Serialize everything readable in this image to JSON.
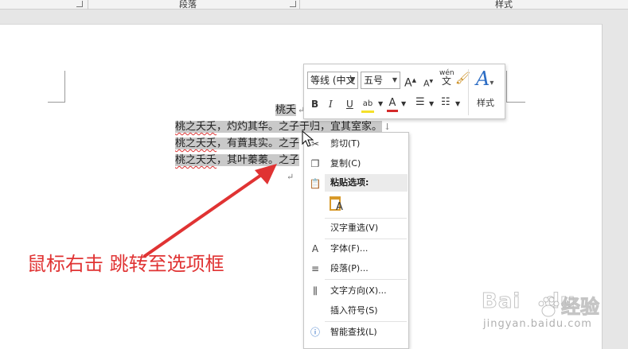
{
  "ribbon": {
    "group_paragraph": "段落",
    "group_styles": "样式"
  },
  "document": {
    "title_line": "桃夭",
    "lines": [
      {
        "left": "桃之夭夭",
        "rest": "，灼灼其华。之子于归，宜其室家。"
      },
      {
        "left": "桃之夭夭",
        "rest": "，有蕡其实。之子"
      },
      {
        "left": "桃之夭夭",
        "rest": "，其叶蓁蓁。之子"
      }
    ],
    "paragraph_mark": "↵",
    "line_mark": "↓"
  },
  "mini_toolbar": {
    "font_name": "等线 (中文",
    "font_size": "五号",
    "grow_font": "A",
    "shrink_font": "A",
    "phonetic": "wén",
    "bold": "B",
    "italic": "I",
    "underline": "U",
    "styles_label": "样式",
    "highlight_color": "#f5e02a",
    "font_color": "#d42a2a"
  },
  "context_menu": {
    "cut": "剪切(T)",
    "copy": "复制(C)",
    "paste_options": "粘贴选项:",
    "reconvert": "汉字重选(V)",
    "font": "字体(F)...",
    "paragraph": "段落(P)...",
    "text_direction": "文字方向(X)...",
    "insert_symbol": "插入符号(S)",
    "smart_lookup": "智能查找(L)"
  },
  "annotation": {
    "text": "鼠标右击 跳转至选项框",
    "color": "#e03333"
  },
  "watermark": {
    "brand": "Bai",
    "brand_end": "du",
    "chinese": "经验",
    "url": "jingyan.baidu.com"
  }
}
